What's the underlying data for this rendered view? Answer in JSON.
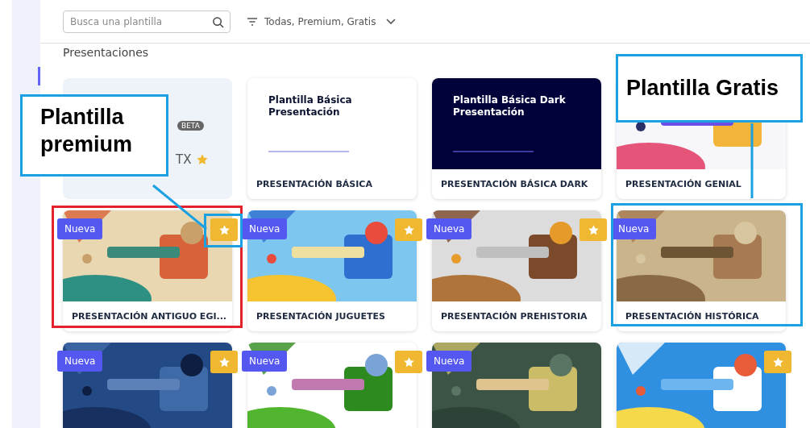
{
  "search": {
    "placeholder": "Busca una plantilla"
  },
  "filter": {
    "label": "Todas, Premium, Gratis"
  },
  "section_title": "Presentaciones",
  "cards": [
    {
      "kind": "import",
      "badge": "BETA",
      "format": "TX",
      "premium": true
    },
    {
      "kind": "slide",
      "dark": false,
      "heading": [
        "Plantilla Básica",
        "Presentación"
      ],
      "title": "PRESENTACIÓN BÁSICA",
      "premium": false
    },
    {
      "kind": "slide",
      "dark": true,
      "heading": [
        "Plantilla Básica Dark",
        "Presentación"
      ],
      "title": "PRESENTACIÓN BÁSICA DARK",
      "premium": false
    },
    {
      "kind": "picture",
      "title": "PRESENTACIÓN GENIAL",
      "premium": false
    },
    {
      "kind": "picture",
      "title": "PRESENTACIÓN ANTIGUO EGI...",
      "badge": "Nueva",
      "premium": true
    },
    {
      "kind": "picture",
      "title": "PRESENTACIÓN JUGUETES",
      "badge": "Nueva",
      "premium": true
    },
    {
      "kind": "picture",
      "title": "PRESENTACIÓN PREHISTORIA",
      "badge": "Nueva",
      "premium": true
    },
    {
      "kind": "picture",
      "title": "PRESENTACIÓN HISTÓRICA",
      "badge": "Nueva",
      "premium": false
    },
    {
      "kind": "picture",
      "badge": "Nueva",
      "premium": true
    },
    {
      "kind": "picture",
      "badge": "Nueva",
      "premium": true
    },
    {
      "kind": "picture",
      "badge": "Nueva",
      "premium": false
    },
    {
      "kind": "picture",
      "premium": true
    }
  ],
  "premium_callout": {
    "text": "Plantilla premium"
  },
  "free_callout": {
    "text": "Plantilla Gratis"
  }
}
